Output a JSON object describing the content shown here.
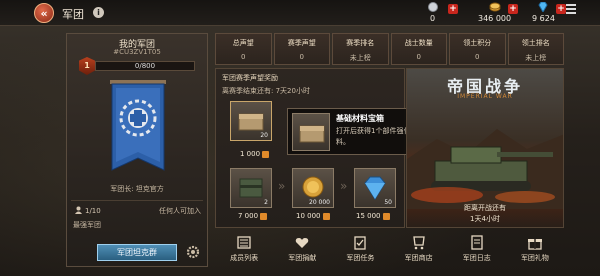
{
  "header": {
    "back_icon": "double-chevron-left-icon",
    "title": "军团",
    "info_icon": "i",
    "resources": [
      {
        "icon": "silver-coin-icon",
        "value": "0"
      },
      {
        "icon": "gold-coin-icon",
        "value": "346 000"
      },
      {
        "icon": "diamond-icon",
        "value": "9 624"
      }
    ],
    "plus_label": "+"
  },
  "corps": {
    "panel_title": "我的军团",
    "id": "#CU3ZV1T05",
    "level": "1",
    "xp": "0/800",
    "xp_fraction": 0,
    "leader": "军团长: 坦克官方",
    "members": "1/10",
    "join_mode": "任何人可加入",
    "slogan": "最强军团",
    "group_button": "军团坦克群"
  },
  "stats": [
    {
      "label": "总声望",
      "value": "0"
    },
    {
      "label": "赛季声望",
      "value": "0"
    },
    {
      "label": "赛季排名",
      "value": "未上榜"
    },
    {
      "label": "战士数量",
      "value": "0"
    },
    {
      "label": "领土积分",
      "value": "0"
    },
    {
      "label": "领土排名",
      "value": "未上榜"
    }
  ],
  "rewards": {
    "title": "军团赛季声望奖励",
    "time_left": "离赛季结束还有: 7天20小时",
    "items": [
      {
        "name": "chest-1",
        "count": "20",
        "price": "1 000"
      },
      {
        "name": "supply-box",
        "count": "2",
        "price": "7 000"
      },
      {
        "name": "gold-coins",
        "count": "20 000",
        "price": "10 000"
      },
      {
        "name": "diamonds",
        "count": "50",
        "price": "15 000"
      }
    ]
  },
  "tooltip": {
    "name": "基础材料宝箱",
    "description": "打开后获得1个部件强化基础材料。"
  },
  "event": {
    "title": "帝国战争",
    "subtitle": "IMPERIAL WAR",
    "start_label": "距离开战还有",
    "countdown": "1天4小时"
  },
  "nav": [
    {
      "label": "成员列表",
      "icon": "members-icon"
    },
    {
      "label": "军团捐献",
      "icon": "donate-icon"
    },
    {
      "label": "军团任务",
      "icon": "missions-icon"
    },
    {
      "label": "军团商店",
      "icon": "shop-icon"
    },
    {
      "label": "军团日志",
      "icon": "log-icon"
    },
    {
      "label": "军团礼物",
      "icon": "gift-icon"
    }
  ],
  "colors": {
    "accent_red": "#c8261d",
    "button_blue": "#2a5f80",
    "banner_blue": "#2c5fa8"
  }
}
